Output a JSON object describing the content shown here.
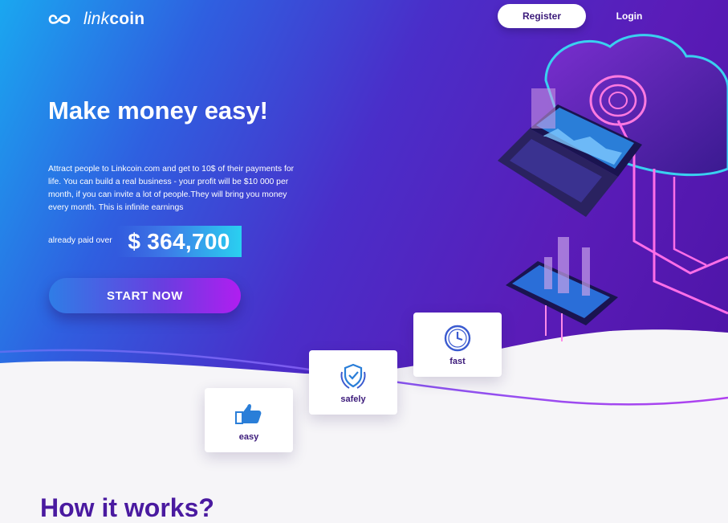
{
  "header": {
    "logo_text_light": "link",
    "logo_text_bold": "coin",
    "register_label": "Register",
    "login_label": "Login"
  },
  "hero": {
    "headline": "Make money easy!",
    "description": "Attract people to Linkcoin.com and get to 10$ of their payments for life. You can build a real business - your profit will be $10 000 per month, if you can invite a lot of people.They will bring you money every month. This is infinite earnings",
    "paid_label": "already paid over",
    "paid_amount": "$ 364,700",
    "start_label": "START NOW"
  },
  "features": [
    {
      "label": "easy",
      "icon": "thumbs-up-icon"
    },
    {
      "label": "safely",
      "icon": "shield-laurel-icon"
    },
    {
      "label": "fast",
      "icon": "clock-icon"
    }
  ],
  "section": {
    "how_title": "How it works?"
  },
  "colors": {
    "accent_purple": "#3b1a7a",
    "gradient_start": "#1aa7f0",
    "gradient_end": "#4a12a2",
    "cta_pink": "#b01ef0"
  }
}
